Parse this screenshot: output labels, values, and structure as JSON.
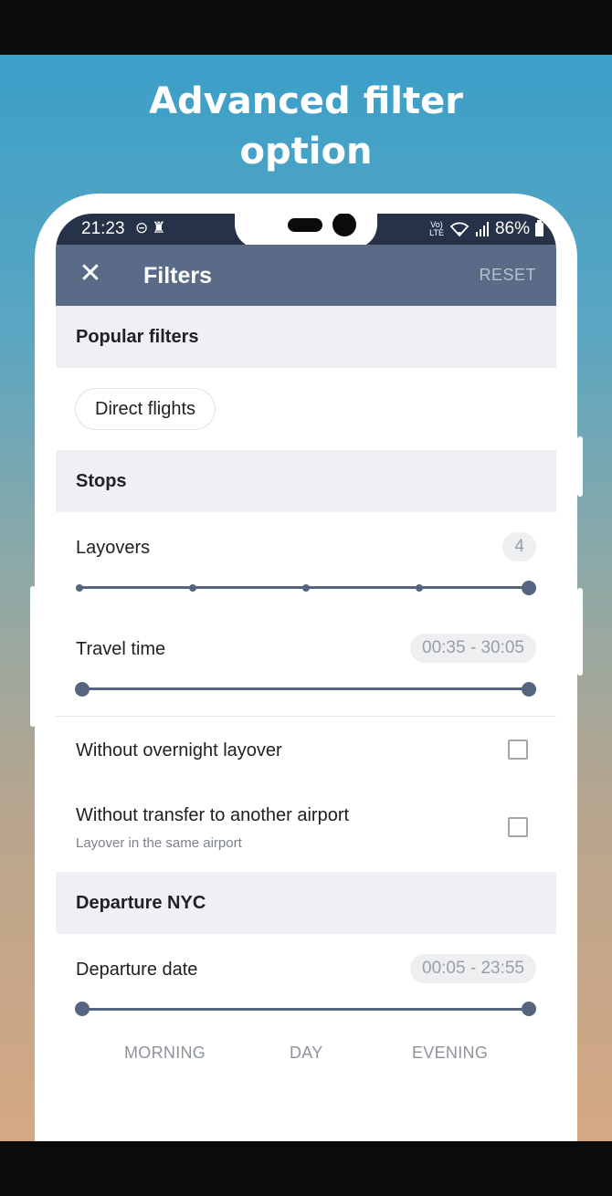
{
  "headline": {
    "line1": "Advanced filter",
    "line2": "option"
  },
  "status_bar": {
    "time": "21:23",
    "left_icons": [
      "do-not-disturb-icon",
      "keyhole-icon"
    ],
    "net_top": "Vo)",
    "net_bottom": "LTE",
    "right_icons": [
      "wifi-icon",
      "signal-icon"
    ],
    "battery": "86%"
  },
  "app_bar": {
    "title": "Filters",
    "reset": "RESET",
    "close_icon": "close-icon"
  },
  "popular_filters": {
    "header": "Popular filters",
    "chip": "Direct flights"
  },
  "stops": {
    "header": "Stops",
    "layovers_label": "Layovers",
    "layovers_value": "4",
    "layovers_max": 4,
    "travel_time_label": "Travel time",
    "travel_time_value": "00:35 - 30:05",
    "overnight_label": "Without overnight layover",
    "overnight_checked": false,
    "transfer_label": "Without transfer to another airport",
    "transfer_sublabel": "Layover in the same airport",
    "transfer_checked": false
  },
  "departure": {
    "header": "Departure NYC",
    "date_label": "Departure date",
    "date_value": "00:05 - 23:55",
    "time_labels": [
      "MORNING",
      "DAY",
      "EVENING"
    ]
  },
  "colors": {
    "app_bar": "#5a6b87",
    "slider": "#56657f",
    "status_bar": "#263247"
  }
}
